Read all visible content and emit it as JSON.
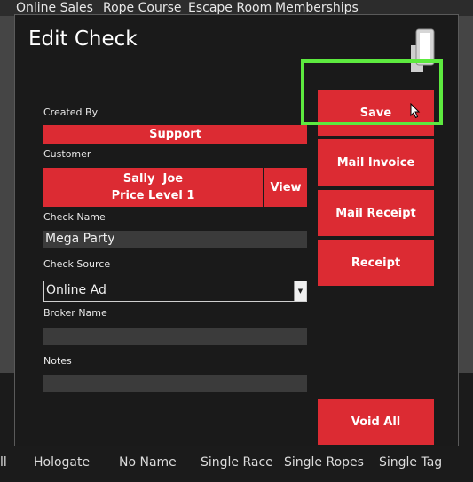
{
  "top_tabs": [
    "Online Sales",
    "Rope Course",
    "Escape Room",
    "Memberships"
  ],
  "bottom_tabs": [
    "ll",
    "Hologate",
    "No Name",
    "Single Race",
    "Single Ropes",
    "Single Tag"
  ],
  "dialog": {
    "title": "Edit Check",
    "icon": "phone-icon"
  },
  "form": {
    "created_by_label": "Created By",
    "created_by_value": "Support",
    "customer_label": "Customer",
    "customer_name": "Sally  Joe",
    "customer_price_level": "Price Level 1",
    "view_button": "View",
    "check_name_label": "Check Name",
    "check_name_value": "Mega Party",
    "check_source_label": "Check Source",
    "check_source_value": "Online Ad",
    "broker_name_label": "Broker Name",
    "broker_name_value": "",
    "notes_label": "Notes",
    "notes_value": ""
  },
  "actions": {
    "save": "Save",
    "mail_invoice": "Mail Invoice",
    "mail_receipt": "Mail Receipt",
    "receipt": "Receipt",
    "void_all": "Void All"
  },
  "colors": {
    "accent_red": "#dc2b33",
    "highlight_green": "#5dea3f",
    "dialog_bg": "#1a1a1a"
  }
}
